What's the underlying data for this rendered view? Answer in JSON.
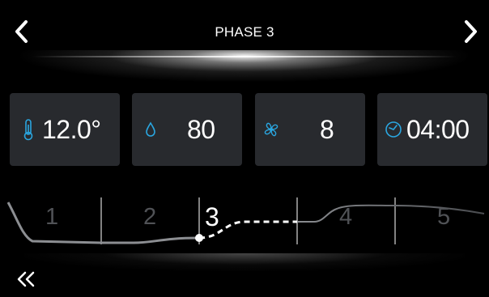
{
  "header": {
    "title": "PHASE 3"
  },
  "cards": {
    "temperature": {
      "value": "12.0°",
      "icon": "thermometer-icon"
    },
    "humidity": {
      "value": "80",
      "icon": "water-drop-icon"
    },
    "fan": {
      "value": "8",
      "icon": "fan-icon"
    },
    "time": {
      "value": "04:00",
      "icon": "clock-icon"
    }
  },
  "phases": {
    "labels": [
      "1",
      "2",
      "3",
      "4",
      "5"
    ],
    "active": "3"
  },
  "footer": {
    "back_icon": "double-chevron-left-icon"
  },
  "colors": {
    "accent": "#2aa6e0",
    "card_bg": "#282a2e",
    "background": "#000000"
  }
}
